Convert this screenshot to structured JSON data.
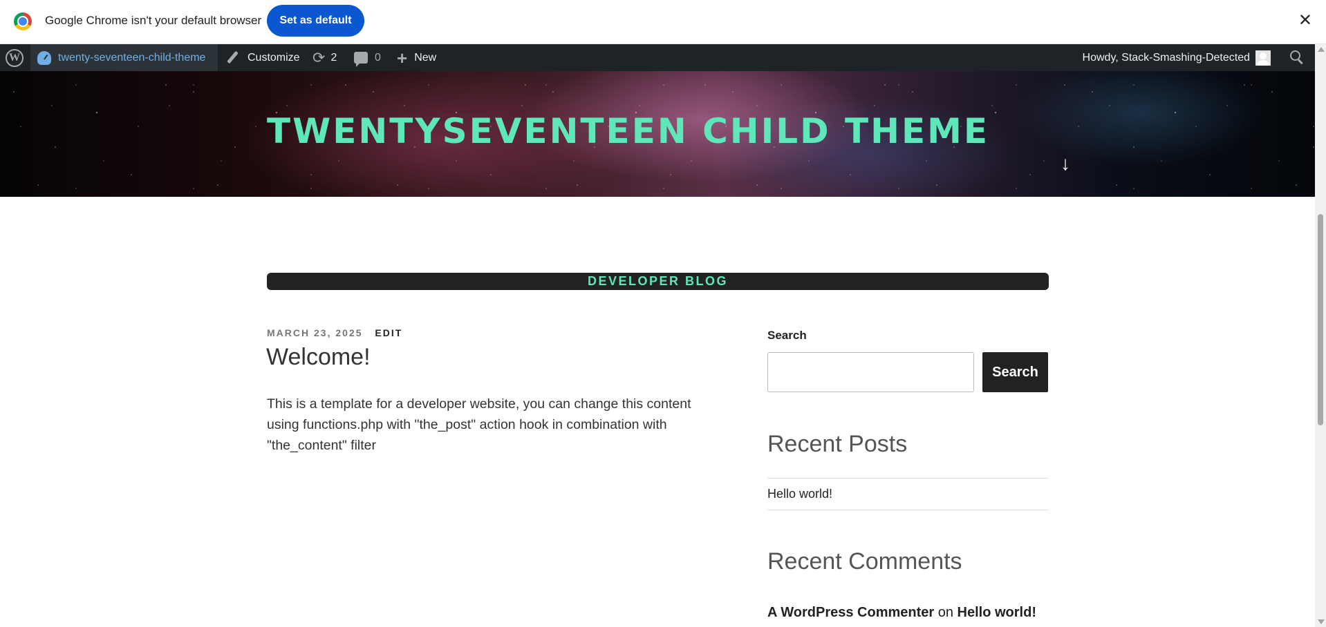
{
  "infobar": {
    "message": "Google Chrome isn't your default browser",
    "button": "Set as default",
    "close": "✕"
  },
  "adminbar": {
    "site_name": "twenty-seventeen-child-theme",
    "customize": "Customize",
    "updates_count": "2",
    "comments_count": "0",
    "new": "New",
    "howdy": "Howdy, Stack-Smashing-Detected"
  },
  "header": {
    "site_title": "TWENTYSEVENTEEN CHILD THEME",
    "scroll_arrow": "↓"
  },
  "page": {
    "banner": "DEVELOPER BLOG"
  },
  "post": {
    "date": "MARCH 23, 2025",
    "edit": "EDIT",
    "title": "Welcome!",
    "body": "This is a template for a developer website, you can change this content using functions.php with \"the_post\" action hook in combination with \"the_content\" filter"
  },
  "sidebar": {
    "search_label": "Search",
    "search_value": "",
    "search_button": "Search",
    "recent_posts_title": "Recent Posts",
    "recent_posts": [
      "Hello world!"
    ],
    "recent_comments_title": "Recent Comments",
    "recent_comment": {
      "author": "A WordPress Commenter",
      "on": "on",
      "post": "Hello world!"
    }
  }
}
